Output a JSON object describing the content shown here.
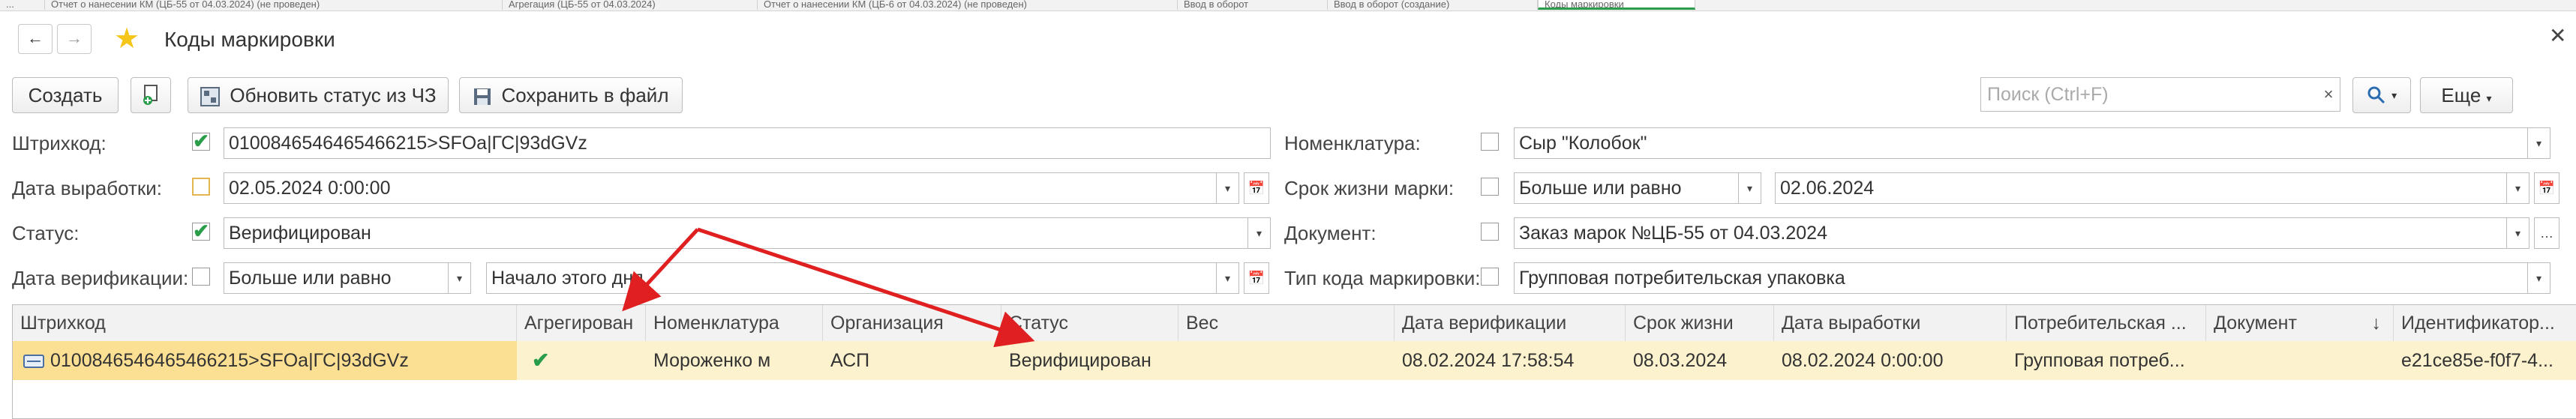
{
  "top_tabs": [
    "...",
    "Отчет о нанесении КМ (ЦБ-55 от 04.03.2024) (не проведен)",
    "Агрегация (ЦБ-55 от 04.03.2024)",
    "Отчет о нанесении КМ (ЦБ-6 от 04.03.2024) (не проведен)",
    "Ввод в оборот",
    "Ввод в оборот (создание)",
    "Коды маркировки"
  ],
  "header": {
    "back_icon": "arrow-left",
    "forward_icon": "arrow-right",
    "star_icon": "star",
    "title": "Коды маркировки",
    "close_icon": "close"
  },
  "toolbar": {
    "create_label": "Создать",
    "copy_icon": "copy-add",
    "refresh_label": "Обновить статус из ЧЗ",
    "save_label": "Сохранить в файл",
    "search_placeholder": "Поиск (Ctrl+F)",
    "search_clear": "×",
    "search_icon": "magnifier",
    "more_label": "Еще"
  },
  "filters": {
    "barcode": {
      "label": "Штрихкод:",
      "checked": true,
      "value": "0100846546465466215>SFOa|ГС|93dGVz"
    },
    "production_date": {
      "label": "Дата выработки:",
      "checked": false,
      "value": "02.05.2024  0:00:00"
    },
    "status": {
      "label": "Статус:",
      "checked": true,
      "value": "Верифицирован"
    },
    "verification_date": {
      "label": "Дата верификации:",
      "checked": false,
      "condition": "Больше или равно",
      "value": "Начало этого дня"
    },
    "nomenclature": {
      "label": "Номенклатура:",
      "checked": false,
      "value": "Сыр \"Колобок\""
    },
    "mark_lifetime": {
      "label": "Срок жизни марки:",
      "checked": false,
      "condition": "Больше или равно",
      "value": "02.06.2024"
    },
    "document": {
      "label": "Документ:",
      "checked": false,
      "value": "Заказ марок №ЦБ-55 от 04.03.2024"
    },
    "code_type": {
      "label": "Тип кода маркировки:",
      "checked": false,
      "value": "Групповая потребительская упаковка"
    }
  },
  "table": {
    "columns": [
      "Штрихкод",
      "Агрегирован",
      "Номенклатура",
      "Организация",
      "Статус",
      "Вес",
      "Дата верификации",
      "Срок жизни",
      "Дата выработки",
      "Потребительская ...",
      "Документ",
      "Идентификатор..."
    ],
    "sort_indicator": "↓",
    "rows": [
      {
        "barcode": "0100846546465466215>SFOa|ГС|93dGVz",
        "aggregated": "✔",
        "nomenclature": "Мороженко м",
        "organization": "АСП",
        "status": "Верифицирован",
        "weight": "",
        "verification_date": "08.02.2024 17:58:54",
        "lifetime": "08.03.2024",
        "production_date": "08.02.2024 0:00:00",
        "consumer": "Групповая потреб...",
        "document": "",
        "identifier": "e21ce85e-f0f7-4..."
      }
    ]
  },
  "colors": {
    "accent_green": "#2a9d4a",
    "star_yellow": "#f5c518",
    "selected_row": "#fcf2cd",
    "selected_cell": "#fbe094",
    "annotation_arrow": "#e02020"
  }
}
